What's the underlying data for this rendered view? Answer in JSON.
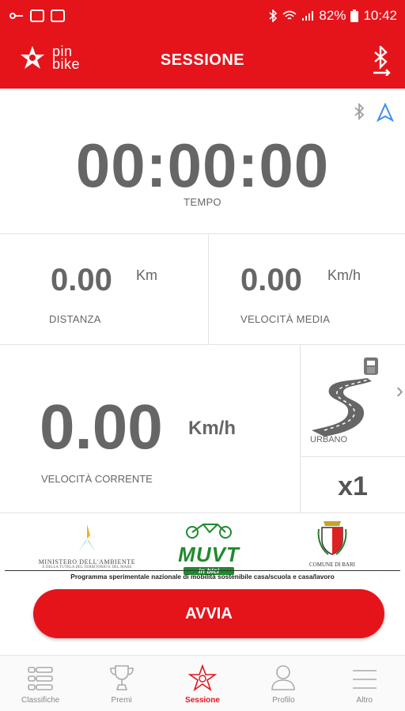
{
  "status_bar": {
    "battery": "82%",
    "time": "10:42"
  },
  "app_bar": {
    "logo_text_line1": "pin",
    "logo_text_line2": "bike",
    "title": "SESSIONE"
  },
  "timer": {
    "value": "00:00:00",
    "label": "TEMPO"
  },
  "distance": {
    "value": "0.00",
    "unit": "Km",
    "label": "DISTANZA"
  },
  "avg_speed": {
    "value": "0.00",
    "unit": "Km/h",
    "label": "VELOCITÀ MEDIA"
  },
  "current_speed": {
    "value": "0.00",
    "unit": "Km/h",
    "label": "VELOCITÀ CORRENTE"
  },
  "mode": {
    "label": "URBANO"
  },
  "multiplier": {
    "value": "x1"
  },
  "sponsors": {
    "ministry_name": "MINISTERO DELL'AMBIENTE",
    "ministry_sub": "E DELLA TUTELA DEL TERRITORIO E DEL MARE",
    "muvt_title": "MUVT",
    "muvt_sub": "in bici",
    "comune_name": "COMUNE DI BARI",
    "program_text": "Programma sperimentale nazionale di mobilità sostenibile casa/scuola e casa/lavoro"
  },
  "start_button": {
    "label": "AVVIA"
  },
  "bottom_nav": {
    "items": [
      {
        "label": "Classifiche",
        "icon": "list-icon"
      },
      {
        "label": "Premi",
        "icon": "trophy-icon"
      },
      {
        "label": "Sessione",
        "icon": "star-icon",
        "active": true
      },
      {
        "label": "Profilo",
        "icon": "person-icon"
      },
      {
        "label": "Altro",
        "icon": "menu-icon"
      }
    ]
  },
  "colors": {
    "brand_red": "#e5141b",
    "text_gray": "#666666",
    "bluetooth_gray": "#9e9e9e",
    "nav_arrow_blue": "#3f8ee8",
    "muvt_green": "#1f8a2e"
  }
}
